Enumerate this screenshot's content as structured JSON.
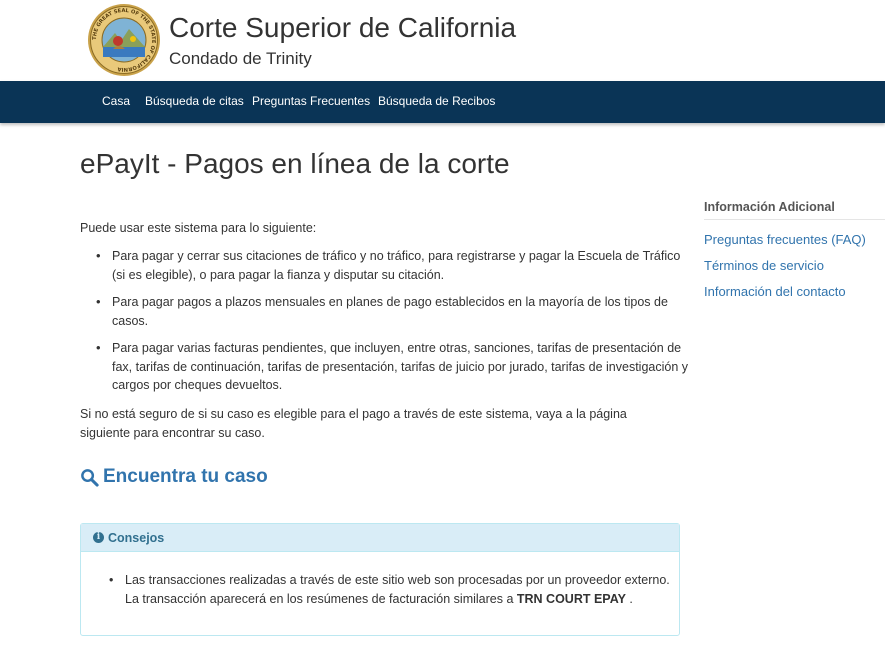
{
  "header": {
    "title": "Corte Superior de California",
    "subtitle": "Condado de Trinity",
    "seal_text": "THE GREAT SEAL OF THE STATE OF CALIFORNIA"
  },
  "nav": {
    "items": [
      "Casa",
      "Búsqueda de citas",
      "Preguntas Frecuentes",
      "Búsqueda de Recibos"
    ]
  },
  "main": {
    "title": "ePayIt - Pagos en línea de la corte",
    "intro": "Puede usar este sistema para lo siguiente:",
    "bullets": [
      "Para pagar y cerrar sus citaciones de tráfico y no tráfico, para registrarse y pagar la Escuela de Tráfico (si es elegible), o para pagar la fianza y disputar su citación.",
      "Para pagar pagos a plazos mensuales en planes de pago establecidos en la mayoría de los tipos de casos.",
      "Para pagar varias facturas pendientes, que incluyen, entre otras, sanciones, tarifas de presentación de fax, tarifas de continuación, tarifas de presentación, tarifas de juicio por jurado, tarifas de investigación y cargos por cheques devueltos."
    ],
    "note": "Si no está seguro de si su caso es elegible para el pago a través de este sistema, vaya a la página siguiente para encontrar su caso.",
    "find_case": "Encuentra tu caso"
  },
  "tips": {
    "title": "Consejos",
    "text_before": "Las transacciones realizadas a través de este sitio web son procesadas por un proveedor externo. La transacción aparecerá en los resúmenes de facturación similares a ",
    "highlight": "TRN COURT EPAY",
    "text_after": " ."
  },
  "sidebar": {
    "title": "Información Adicional",
    "links": [
      "Preguntas frecuentes (FAQ)",
      "Términos de servicio",
      "Información del contacto"
    ]
  },
  "colors": {
    "navbar": "#0a3456",
    "link": "#3174ad",
    "info_bg": "#d9edf7",
    "info_text": "#31708f"
  }
}
